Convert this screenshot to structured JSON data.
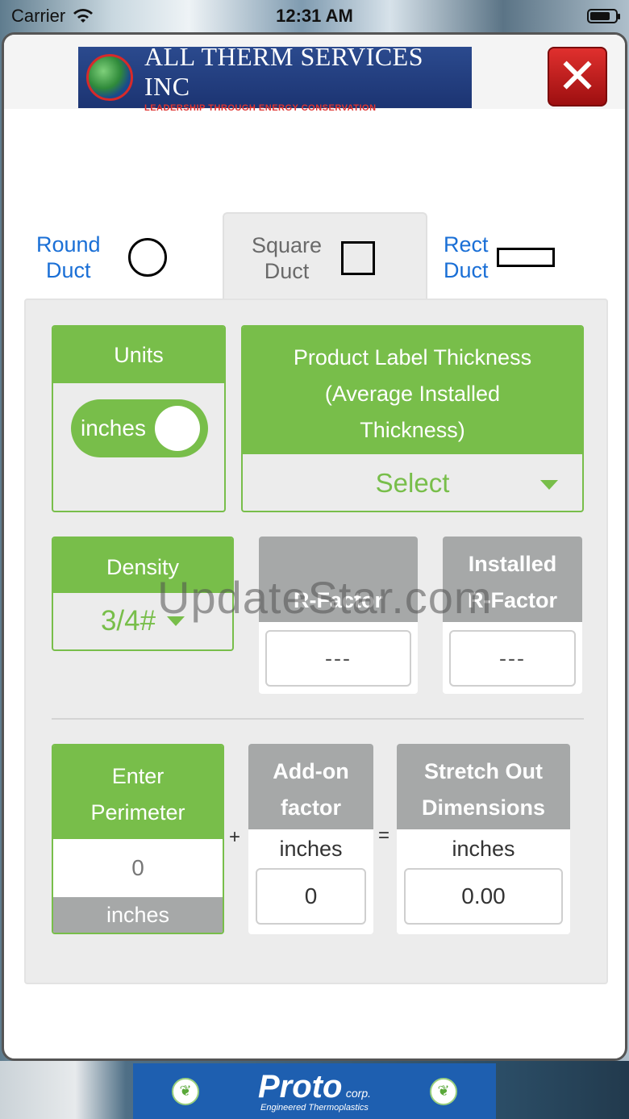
{
  "status_bar": {
    "carrier": "Carrier",
    "time": "12:31 AM"
  },
  "header": {
    "logo_title": "ALL THERM SERVICES INC",
    "logo_tagline": "LEADERSHIP THROUGH ENERGY CONSERVATION",
    "close_symbol": "✕"
  },
  "tabs": [
    {
      "label_line1": "Round",
      "label_line2": "Duct",
      "icon": "circle-icon",
      "selected": false
    },
    {
      "label_line1": "Square",
      "label_line2": "Duct",
      "icon": "square-icon",
      "selected": true
    },
    {
      "label_line1": "Rect",
      "label_line2": "Duct",
      "icon": "rectangle-icon",
      "selected": false
    }
  ],
  "units": {
    "title": "Units",
    "toggle_value": "inches"
  },
  "product_label": {
    "title_line1": "Product Label Thickness",
    "title_line2": "(Average Installed",
    "title_line3": "Thickness)",
    "select_value": "Select"
  },
  "density": {
    "title": "Density",
    "value": "3/4#"
  },
  "r_factor": {
    "title_line1": "",
    "title_line2": "R-Factor",
    "value": "---"
  },
  "installed_r_factor": {
    "title_line1": "Installed",
    "title_line2": "R-Factor",
    "value": "---"
  },
  "perimeter": {
    "title_line1": "Enter",
    "title_line2": "Perimeter",
    "value": "0",
    "unit": "inches"
  },
  "operators": {
    "plus": "+",
    "equals": "="
  },
  "addon": {
    "title_line1": "Add-on",
    "title_line2": "factor",
    "unit": "inches",
    "value": "0"
  },
  "stretch_out": {
    "title_line1": "Stretch Out",
    "title_line2": "Dimensions",
    "unit": "inches",
    "value": "0.00"
  },
  "watermark": "UpdateStar.com",
  "footer": {
    "brand": "Proto",
    "corp": "corp.",
    "subtitle": "Engineered Thermoplastics"
  },
  "colors": {
    "accent_green": "#78be4a",
    "link_blue": "#1a6fd6",
    "header_gray": "#a6a8a8",
    "close_red": "#c41e1e"
  }
}
